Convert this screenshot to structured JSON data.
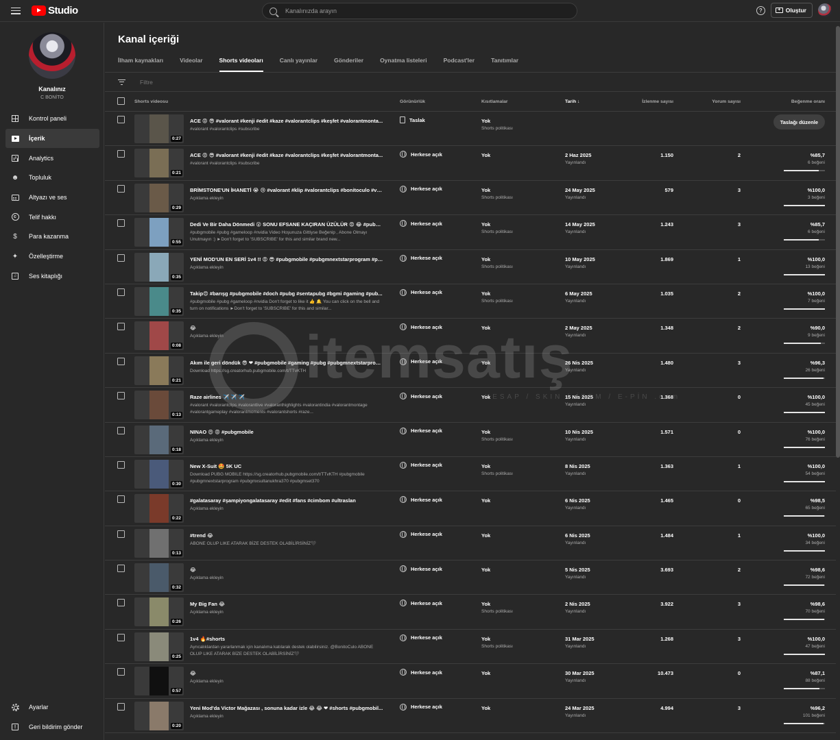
{
  "app": {
    "logo_text": "Studio"
  },
  "search": {
    "placeholder": "Kanalınızda arayın"
  },
  "header": {
    "create_label": "Oluştur",
    "help_glyph": "?"
  },
  "channel": {
    "name": "Kanalınız",
    "handle": "C BONİTO"
  },
  "sidebar": {
    "items": [
      {
        "label": "Kontrol paneli",
        "icon": "dashboard-icon"
      },
      {
        "label": "İçerik",
        "icon": "content-icon",
        "active": true
      },
      {
        "label": "Analytics",
        "icon": "analytics-icon"
      },
      {
        "label": "Topluluk",
        "icon": "community-icon"
      },
      {
        "label": "Altyazı ve ses",
        "icon": "subtitles-icon"
      },
      {
        "label": "Telif hakkı",
        "icon": "copyright-icon"
      },
      {
        "label": "Para kazanma",
        "icon": "monetization-icon"
      },
      {
        "label": "Özelleştirme",
        "icon": "customization-icon"
      },
      {
        "label": "Ses kitaplığı",
        "icon": "audio-library-icon"
      }
    ],
    "bottom": [
      {
        "label": "Ayarlar",
        "icon": "settings-icon"
      },
      {
        "label": "Geri bildirim gönder",
        "icon": "feedback-icon"
      }
    ]
  },
  "main": {
    "title": "Kanal içeriği",
    "tabs": [
      "İlham kaynakları",
      "Videolar",
      "Shorts videoları",
      "Canlı yayınlar",
      "Gönderiler",
      "Oynatma listeleri",
      "Podcast'ler",
      "Tanıtımlar"
    ],
    "active_tab": 2,
    "filter_placeholder": "Filtre"
  },
  "table": {
    "columns": {
      "video": "Shorts videosu",
      "visibility": "Görünürlük",
      "restrictions": "Kısıtlamalar",
      "date": "Tarih",
      "views": "İzlenme sayısı",
      "comments": "Yorum sayısı",
      "likes": "Beğenme oranı"
    },
    "rows": [
      {
        "title": "ACE 😡 😎 #valorant #kenji #edit #kaze #valorantclips #keşfet #valorantmonta...",
        "desc": "#valorant #valorantclips #subscribe",
        "duration": "0:27",
        "visibility": "Taslak",
        "vis_icon": "draft-icon",
        "restriction": "Yok",
        "restriction_sub": "Shorts politikası",
        "date": "",
        "date_sub": "",
        "views": "",
        "comments": "",
        "likes": "",
        "likes_sub": "",
        "like_ratio": 0,
        "action": "Taslağı düzenle",
        "tone": "#5a554a"
      },
      {
        "title": "ACE 😡 😎 #valorant #kenji #edit #kaze #valorantclips #keşfet #valorantmonta...",
        "desc": "#valorant #valorantclips #subscribe",
        "duration": "0:21",
        "visibility": "Herkese açık",
        "vis_icon": "globe-icon",
        "restriction": "Yok",
        "restriction_sub": "",
        "date": "2 Haz 2025",
        "date_sub": "Yayınlandı",
        "views": "1.150",
        "comments": "2",
        "likes": "%85,7",
        "likes_sub": "6 beğeni",
        "like_ratio": 85.7,
        "tone": "#7a6e55"
      },
      {
        "title": "BRİMSTONE'UN İHANETİ 😭 😢 #valorant #klip #valorantclips #bonitoculo #val...",
        "desc": "Açıklama ekleyin",
        "duration": "0:29",
        "visibility": "Herkese açık",
        "vis_icon": "globe-icon",
        "restriction": "Yok",
        "restriction_sub": "Shorts politikası",
        "date": "24 May 2025",
        "date_sub": "Yayınlandı",
        "views": "579",
        "comments": "3",
        "likes": "%100,0",
        "likes_sub": "3 beğeni",
        "like_ratio": 100,
        "tone": "#6a5a48"
      },
      {
        "title": "Dedi Ve Bir Daha Dönmedi 😮 SONU EFSANE KAÇIRAN ÜZÜLÜR 😡 😂 #pubgm...",
        "desc": "#pubgmobile #pubg #gameloop #nvidia Video Hoşunuza Gittiyse Beğenip , Abone Olmayı Unutmayın :) ►Don't forget to 'SUBSCRIBE' for this and similar brand new...",
        "duration": "0:55",
        "visibility": "Herkese açık",
        "vis_icon": "globe-icon",
        "restriction": "Yok",
        "restriction_sub": "Shorts politikası",
        "date": "14 May 2025",
        "date_sub": "Yayınlandı",
        "views": "1.243",
        "comments": "3",
        "likes": "%85,7",
        "likes_sub": "6 beğeni",
        "like_ratio": 85.7,
        "tone": "#7da0c0"
      },
      {
        "title": "YENİ MOD'UN EN SERİ 1v4 !! 😡 😎 #pubgmobile #pubgmnextstarprogram #pu...",
        "desc": "Açıklama ekleyin",
        "duration": "0:35",
        "visibility": "Herkese açık",
        "vis_icon": "globe-icon",
        "restriction": "Yok",
        "restriction_sub": "Shorts politikası",
        "date": "10 May 2025",
        "date_sub": "Yayınlandı",
        "views": "1.869",
        "comments": "1",
        "likes": "%100,0",
        "likes_sub": "13 beğeni",
        "like_ratio": 100,
        "tone": "#8aa8b8"
      },
      {
        "title": "Takip😍 #barışg #pubgmobile #doch #pubg #sentapubg #bgmi #gaming #pub...",
        "desc": "#pubgmobile #pubg #gameloop #nvidia Don't forget to like it 👍 🔔 You can click on the bell and turn on notifications ►Don't forget to 'SUBSCRIBE' for this and similar...",
        "duration": "0:35",
        "visibility": "Herkese açık",
        "vis_icon": "globe-icon",
        "restriction": "Yok",
        "restriction_sub": "Shorts politikası",
        "date": "6 May 2025",
        "date_sub": "Yayınlandı",
        "views": "1.035",
        "comments": "2",
        "likes": "%100,0",
        "likes_sub": "7 beğeni",
        "like_ratio": 100,
        "tone": "#4a8a8a"
      },
      {
        "title": "😂",
        "desc": "Açıklama ekleyin",
        "duration": "0:08",
        "visibility": "Herkese açık",
        "vis_icon": "globe-icon",
        "restriction": "Yok",
        "restriction_sub": "",
        "date": "2 May 2025",
        "date_sub": "Yayınlandı",
        "views": "1.348",
        "comments": "2",
        "likes": "%90,0",
        "likes_sub": "9 beğeni",
        "like_ratio": 90,
        "tone": "#a04848"
      },
      {
        "title": "Akım ile geri döndük 😎 ❤ #pubgmobile #gaming #pubg #pubgmnextstarprogr...",
        "desc": "Download https://sg.creatorhub.pubgmobile.com/t/TTvKTH",
        "duration": "0:21",
        "visibility": "Herkese açık",
        "vis_icon": "globe-icon",
        "restriction": "Yok",
        "restriction_sub": "",
        "date": "26 Nis 2025",
        "date_sub": "Yayınlandı",
        "views": "1.480",
        "comments": "3",
        "likes": "%96,3",
        "likes_sub": "26 beğeni",
        "like_ratio": 96.3,
        "tone": "#8a7a5a"
      },
      {
        "title": "Raze airlines ✈️ ✈️ ✈️",
        "desc": "#valorant #valorantclips #valorantlive #valoranthighlights #valorantindia #valorantmontage #valorantgameplay #valorantmoments #valorantshorts #raze...",
        "duration": "0:13",
        "visibility": "Herkese açık",
        "vis_icon": "globe-icon",
        "restriction": "Yok",
        "restriction_sub": "",
        "date": "15 Nis 2025",
        "date_sub": "Yayınlandı",
        "views": "1.368",
        "comments": "0",
        "likes": "%100,0",
        "likes_sub": "45 beğeni",
        "like_ratio": 100,
        "tone": "#6a4a3a"
      },
      {
        "title": "NINAO 😍 😡 #pubgmobile",
        "desc": "Açıklama ekleyin",
        "duration": "0:18",
        "visibility": "Herkese açık",
        "vis_icon": "globe-icon",
        "restriction": "Yok",
        "restriction_sub": "Shorts politikası",
        "date": "10 Nis 2025",
        "date_sub": "Yayınlandı",
        "views": "1.571",
        "comments": "0",
        "likes": "%100,0",
        "likes_sub": "76 beğeni",
        "like_ratio": 100,
        "tone": "#5a6a7a"
      },
      {
        "title": "New X-Suit 🤩 5K UC",
        "desc": "Download PUBG MOBILE https://sg.creatorhub.pubgmobile.com/t/TTvKTH #pubgmobile #pubgmnextstarprogram #pubgmxsultanukhra370 #pubgmset370",
        "duration": "0:30",
        "visibility": "Herkese açık",
        "vis_icon": "globe-icon",
        "restriction": "Yok",
        "restriction_sub": "Shorts politikası",
        "date": "8 Nis 2025",
        "date_sub": "Yayınlandı",
        "views": "1.363",
        "comments": "1",
        "likes": "%100,0",
        "likes_sub": "54 beğeni",
        "like_ratio": 100,
        "tone": "#4a5a7a"
      },
      {
        "title": "#galatasaray #şampiyongalatasaray #edit #fans #cimbom #ultraslan",
        "desc": "Açıklama ekleyin",
        "duration": "0:22",
        "visibility": "Herkese açık",
        "vis_icon": "globe-icon",
        "restriction": "Yok",
        "restriction_sub": "",
        "date": "6 Nis 2025",
        "date_sub": "Yayınlandı",
        "views": "1.465",
        "comments": "0",
        "likes": "%98,5",
        "likes_sub": "65 beğeni",
        "like_ratio": 98.5,
        "tone": "#7a3a2a"
      },
      {
        "title": "#trend 😂",
        "desc": "ABONE OLUP LIKE ATARAK BİZE DESTEK OLABİLİRSİNİZ🖤",
        "duration": "0:13",
        "visibility": "Herkese açık",
        "vis_icon": "globe-icon",
        "restriction": "Yok",
        "restriction_sub": "",
        "date": "6 Nis 2025",
        "date_sub": "Yayınlandı",
        "views": "1.484",
        "comments": "1",
        "likes": "%100,0",
        "likes_sub": "34 beğeni",
        "like_ratio": 100,
        "tone": "#707070"
      },
      {
        "title": "😂",
        "desc": "Açıklama ekleyin",
        "duration": "0:32",
        "visibility": "Herkese açık",
        "vis_icon": "globe-icon",
        "restriction": "Yok",
        "restriction_sub": "",
        "date": "5 Nis 2025",
        "date_sub": "Yayınlandı",
        "views": "3.693",
        "comments": "2",
        "likes": "%98,6",
        "likes_sub": "72 beğeni",
        "like_ratio": 98.6,
        "tone": "#4a5a6a"
      },
      {
        "title": "My Big Fan 😂",
        "desc": "Açıklama ekleyin",
        "duration": "0:26",
        "visibility": "Herkese açık",
        "vis_icon": "globe-icon",
        "restriction": "Yok",
        "restriction_sub": "Shorts politikası",
        "date": "2 Nis 2025",
        "date_sub": "Yayınlandı",
        "views": "3.922",
        "comments": "3",
        "likes": "%98,6",
        "likes_sub": "70 beğeni",
        "like_ratio": 98.6,
        "tone": "#8a8a6a"
      },
      {
        "title": "1v4 🔥#shorts",
        "desc": "Ayrıcalıklardan yararlanmak için kanalıma katılarak destek olabilirsiniz. @BonitoCulo ABONE OLUP LIKE ATARAK BİZE DESTEK OLABİLİRSİNİZ🖤",
        "duration": "0:25",
        "visibility": "Herkese açık",
        "vis_icon": "globe-icon",
        "restriction": "Yok",
        "restriction_sub": "Shorts politikası",
        "date": "31 Mar 2025",
        "date_sub": "Yayınlandı",
        "views": "1.268",
        "comments": "3",
        "likes": "%100,0",
        "likes_sub": "47 beğeni",
        "like_ratio": 100,
        "tone": "#8a8a7a"
      },
      {
        "title": "😂",
        "desc": "Açıklama ekleyin",
        "duration": "0:57",
        "visibility": "Herkese açık",
        "vis_icon": "globe-icon",
        "restriction": "Yok",
        "restriction_sub": "",
        "date": "30 Mar 2025",
        "date_sub": "Yayınlandı",
        "views": "10.473",
        "comments": "0",
        "likes": "%87,1",
        "likes_sub": "88 beğeni",
        "like_ratio": 87.1,
        "tone": "#101010"
      },
      {
        "title": "Yeni Mod'da Victor Mağazası , sonuna kadar izle 😂 😂 ❤ #shorts #pubgmobil...",
        "desc": "Açıklama ekleyin",
        "duration": "0:20",
        "visibility": "Herkese açık",
        "vis_icon": "globe-icon",
        "restriction": "Yok",
        "restriction_sub": "",
        "date": "24 Mar 2025",
        "date_sub": "Yayınlandı",
        "views": "4.994",
        "comments": "3",
        "likes": "%96,2",
        "likes_sub": "101 beğeni",
        "like_ratio": 96.2,
        "tone": "#8a7a6a"
      }
    ]
  },
  "watermark": {
    "text": "itemsatış",
    "sub": "HESAP / SKIN / İTEM / E-PİN",
    "domain": ".com"
  }
}
